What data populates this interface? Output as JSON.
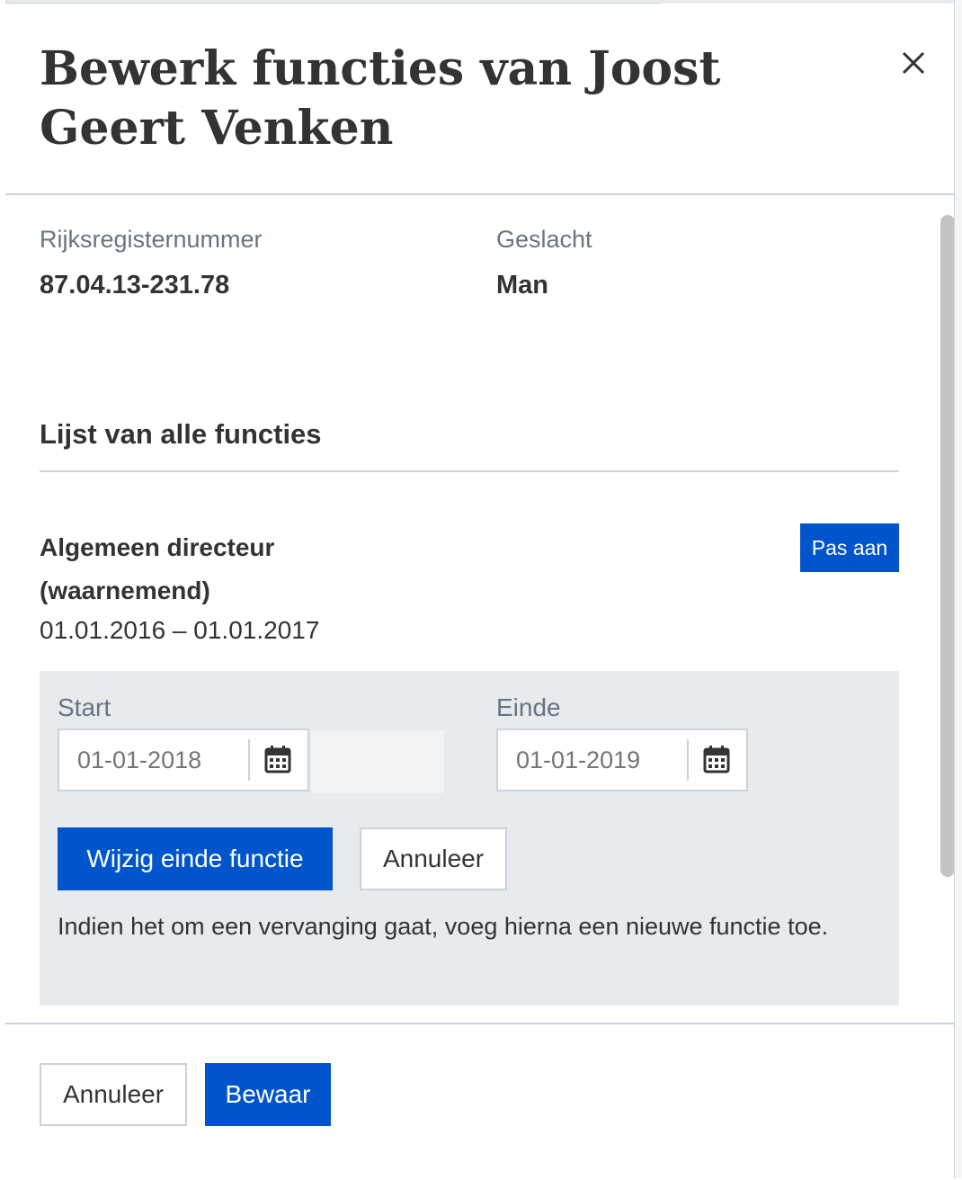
{
  "dialog": {
    "title": "Bewerk functies van Joost Geert Venken",
    "close_label": "×"
  },
  "person": {
    "rrn_label": "Rijksregisternummer",
    "rrn_value": "87.04.13-231.78",
    "gender_label": "Geslacht",
    "gender_value": "Man"
  },
  "functions_section": {
    "title": "Lijst van alle functies"
  },
  "function_item": {
    "title": "Algemeen directeur (waarnemend)",
    "period": "01.01.2016 – 01.01.2017",
    "edit_button": "Pas aan"
  },
  "edit_form": {
    "start_label": "Start",
    "start_placeholder": "01-01-2018",
    "end_label": "Einde",
    "end_placeholder": "01-01-2019",
    "submit_button": "Wijzig einde functie",
    "cancel_button": "Annuleer",
    "info_text": "Indien het om een vervanging gaat, voeg hierna een nieuwe functie toe."
  },
  "footer": {
    "cancel_button": "Annuleer",
    "save_button": "Bewaar"
  },
  "colors": {
    "primary": "#0055cc",
    "text": "#333332",
    "muted": "#687483",
    "panel_bg": "#e8ebee",
    "border": "#cbd2da"
  },
  "icons": [
    "close-icon",
    "calendar-icon"
  ]
}
